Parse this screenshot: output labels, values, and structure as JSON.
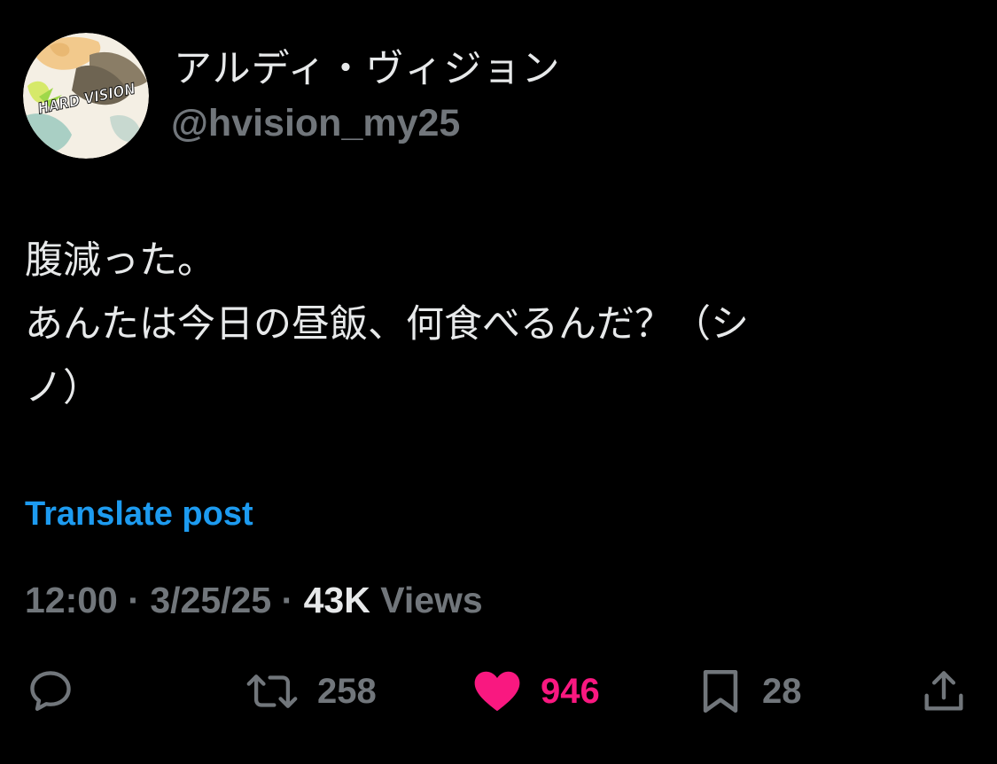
{
  "post": {
    "author": {
      "display_name": "アルディ・ヴィジョン",
      "handle": "@hvision_my25",
      "avatar_text": "HARD VISION"
    },
    "text_lines": [
      "腹減った。",
      "あんたは今日の昼飯、何食べるんだ？（シ",
      "ノ）"
    ],
    "translate_label": "Translate post",
    "time": "12:00",
    "separator": "·",
    "date": "3/25/25",
    "views_count": "43K",
    "views_label": "Views"
  },
  "actions": {
    "reply": {
      "icon": "reply-icon",
      "count": ""
    },
    "repost": {
      "icon": "repost-icon",
      "count": "258"
    },
    "like": {
      "icon": "heart-icon",
      "count": "946",
      "liked": true
    },
    "bookmark": {
      "icon": "bookmark-icon",
      "count": "28"
    },
    "share": {
      "icon": "share-icon",
      "count": ""
    }
  },
  "colors": {
    "background": "#000000",
    "text_primary": "#e7e9ea",
    "text_secondary": "#71767b",
    "link": "#1d9bf0",
    "like": "#f91880"
  }
}
